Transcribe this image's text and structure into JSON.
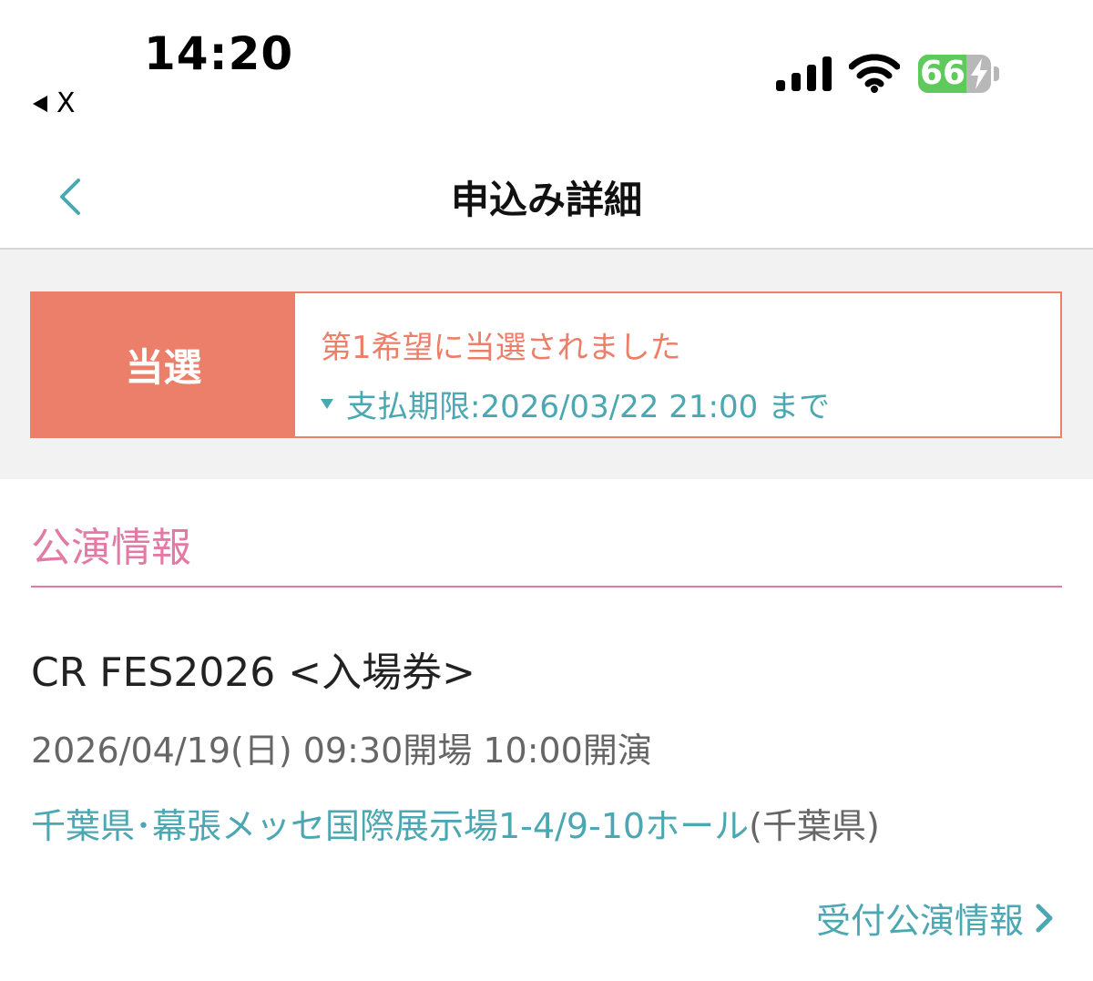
{
  "status_bar": {
    "time": "14:20",
    "back_app_label": "X",
    "battery_percent": "66",
    "battery_level": 0.66,
    "charging": true
  },
  "nav": {
    "title": "申込み詳細"
  },
  "result": {
    "badge": "当選",
    "message": "第1希望に当選されました",
    "deadline": "支払期限:2026/03/22 21:00 まで"
  },
  "performance": {
    "heading": "公演情報",
    "event_name": "CR FES2026 <入場券>",
    "datetime": "2026/04/19(日) 09:30開場 10:00開演",
    "venue": "千葉県･幕張メッセ国際展示場1-4/9-10ホール",
    "venue_pref": "(千葉県)",
    "more_link": "受付公演情報"
  },
  "colors": {
    "accent_teal": "#4ba7b1",
    "win_coral": "#ec7f6a",
    "section_pink": "#e27aa6",
    "battery_green": "#5fca5c"
  },
  "icons": [
    "signal-icon",
    "wifi-icon",
    "battery-icon",
    "bolt-icon",
    "chevron-left-icon",
    "caret-down-icon",
    "chevron-right-icon"
  ]
}
